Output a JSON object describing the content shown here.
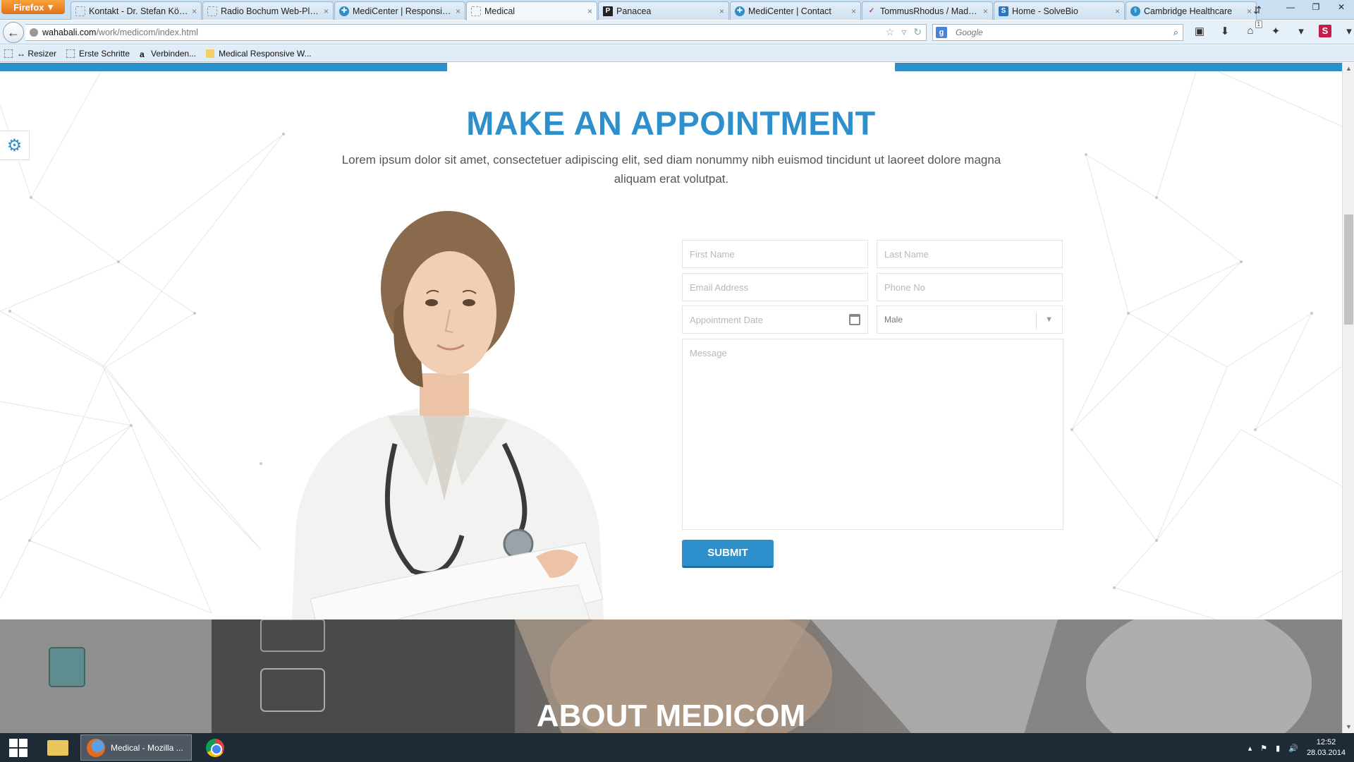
{
  "browser": {
    "menu_label": "Firefox",
    "tabs": [
      {
        "title": "Kontakt - Dr. Stefan Köni...",
        "icon": "blank-page-icon",
        "active": false
      },
      {
        "title": "Radio Bochum Web-Player",
        "icon": "blank-page-icon",
        "active": false
      },
      {
        "title": "MediCenter | Responsive ...",
        "icon": "medicenter-icon",
        "active": false
      },
      {
        "title": "Medical",
        "icon": "blank-page-icon",
        "active": true
      },
      {
        "title": "Panacea",
        "icon": "panacea-icon",
        "active": false
      },
      {
        "title": "MediCenter | Contact",
        "icon": "medicenter-icon",
        "active": false
      },
      {
        "title": "TommusRhodus / Madel...",
        "icon": "tommus-icon",
        "active": false
      },
      {
        "title": "Home - SolveBio",
        "icon": "solvebio-icon",
        "active": false
      },
      {
        "title": "Cambridge Healthcare",
        "icon": "cambridge-icon",
        "active": false
      }
    ],
    "url_host": "wahabali.com",
    "url_path": "/work/medicom/index.html",
    "search_placeholder": "Google",
    "search_engine_letter": "g",
    "bookmarks": [
      {
        "label": "↔ Resizer",
        "icon": "blank-page-icon"
      },
      {
        "label": "Erste Schritte",
        "icon": "blank-page-icon"
      },
      {
        "label": "Verbinden...",
        "icon": "amazon-icon"
      },
      {
        "label": "Medical Responsive W...",
        "icon": "folder-icon"
      }
    ],
    "notification_count": "1",
    "extension_letter": "S"
  },
  "page": {
    "section_title": "MAKE AN APPOINTMENT",
    "section_description": "Lorem ipsum dolor sit amet, consectetuer adipiscing elit, sed diam nonummy nibh euismod tincidunt ut laoreet dolore magna aliquam erat volutpat.",
    "form": {
      "first_name_placeholder": "First Name",
      "last_name_placeholder": "Last Name",
      "email_placeholder": "Email Address",
      "phone_placeholder": "Phone No",
      "date_placeholder": "Appointment Date",
      "gender_selected": "Male",
      "message_placeholder": "Message",
      "submit_label": "SUBMIT"
    },
    "about_title": "ABOUT MEDICOM",
    "accent_color": "#2d8fcb"
  },
  "taskbar": {
    "active_window_label": "Medical - Mozilla ...",
    "clock_time": "12:52",
    "clock_date": "28.03.2014"
  }
}
